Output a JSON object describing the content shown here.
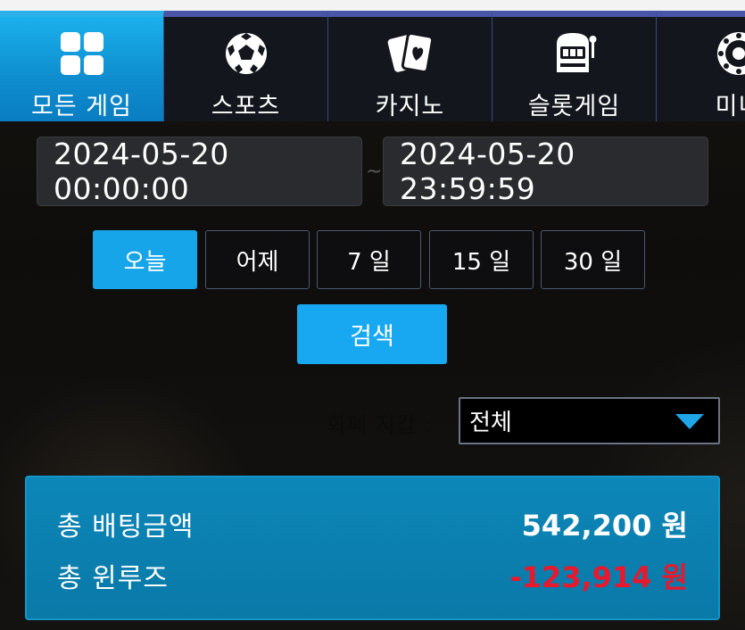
{
  "tabs": [
    {
      "label": "모든 게임",
      "icon": "grid-icon",
      "active": true
    },
    {
      "label": "스포츠",
      "icon": "soccer-ball-icon",
      "active": false
    },
    {
      "label": "카지노",
      "icon": "playing-cards-icon",
      "active": false
    },
    {
      "label": "슬롯게임",
      "icon": "slot-machine-icon",
      "active": false
    },
    {
      "label": "미니",
      "icon": "roulette-icon",
      "active": false
    }
  ],
  "date_range": {
    "start": "2024-05-20 00:00:00",
    "separator": "~",
    "end": "2024-05-20 23:59:59"
  },
  "quick_ranges": [
    "오늘",
    "어제",
    "7 일",
    "15 일",
    "30 일"
  ],
  "search_label": "검색",
  "wallet": {
    "label": "화폐 지갑 :",
    "selected": "전체"
  },
  "summary": {
    "total_bet_label": "총 배팅금액",
    "total_bet_value": "542,200 원",
    "total_winloss_label": "총 윈루즈",
    "total_winloss_value": "-123,914 원"
  },
  "colors": {
    "accent": "#18a8f2",
    "tab_border": "#4a55a8",
    "summary_bg": "#0c87b8",
    "negative": "#e8182d"
  }
}
